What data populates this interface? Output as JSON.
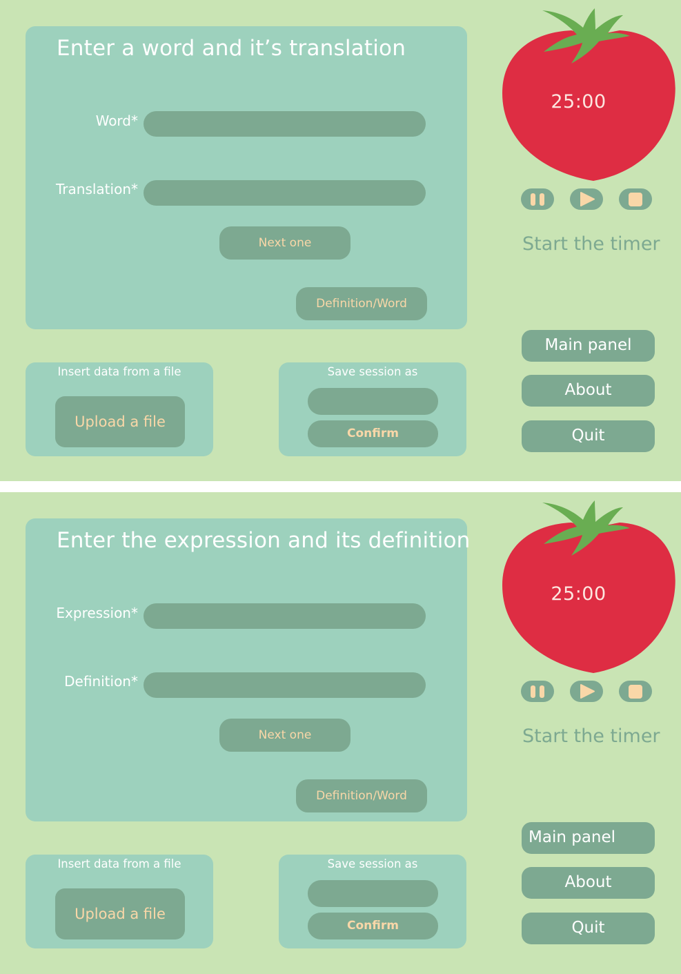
{
  "screens": [
    {
      "heading": "Enter a word and it’s translation",
      "field1_label": "Word*",
      "field2_label": "Translation*",
      "next_label": "Next one",
      "toggle_label": "Definition/Word",
      "file_panel_title": "Insert data from a file",
      "upload_label": "Upload a file",
      "save_panel_title": "Save session as",
      "confirm_label": "Confirm",
      "timer": "25:00",
      "start_text": "Start the timer",
      "nav": [
        "Main panel",
        "About",
        "Quit"
      ]
    },
    {
      "heading": "Enter the expression and its definition",
      "field1_label": "Expression*",
      "field2_label": "Definition*",
      "next_label": "Next one",
      "toggle_label": "Definition/Word",
      "file_panel_title": "Insert data from a file",
      "upload_label": "Upload a file",
      "save_panel_title": "Save session as",
      "confirm_label": "Confirm",
      "timer": "25:00",
      "start_text": "Start the timer",
      "nav": [
        "Main panel",
        "About",
        "Quit"
      ]
    }
  ],
  "icons": {
    "pause": "pause-icon",
    "play": "play-icon",
    "stop": "stop-icon",
    "tomato": "tomato-illustration"
  },
  "colors": {
    "background": "#c9e4b4",
    "panel": "#9dd1bd",
    "control": "#7da991",
    "tomato": "#de2d43",
    "leaves": "#69ad52",
    "accent_text": "#f9d7a8"
  }
}
